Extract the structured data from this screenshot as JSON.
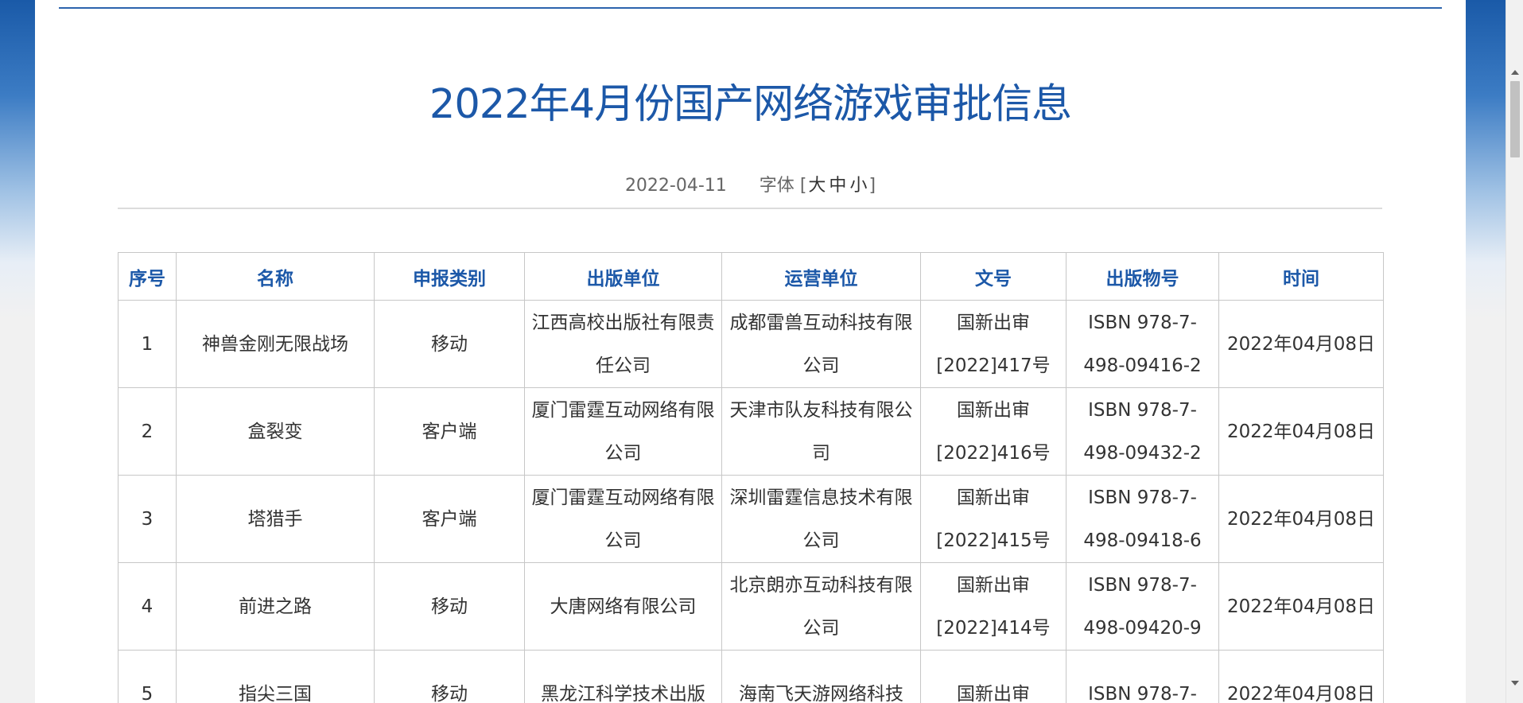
{
  "article": {
    "title": "2022年4月份国产网络游戏审批信息",
    "date": "2022-04-11",
    "font_label": "字体",
    "bracket_open": "[",
    "bracket_close": "]",
    "font_sizes": [
      "大",
      "中",
      "小"
    ]
  },
  "table": {
    "headers": [
      "序号",
      "名称",
      "申报类别",
      "出版单位",
      "运营单位",
      "文号",
      "出版物号",
      "时间"
    ],
    "rows": [
      [
        "1",
        "神兽金刚无限战场",
        "移动",
        "江西高校出版社有限责任公司",
        "成都雷兽互动科技有限公司",
        "国新出审[2022]417号",
        "ISBN 978-7-498-09416-2",
        "2022年04月08日"
      ],
      [
        "2",
        "盒裂变",
        "客户端",
        "厦门雷霆互动网络有限公司",
        "天津市队友科技有限公司",
        "国新出审[2022]416号",
        "ISBN 978-7-498-09432-2",
        "2022年04月08日"
      ],
      [
        "3",
        "塔猎手",
        "客户端",
        "厦门雷霆互动网络有限公司",
        "深圳雷霆信息技术有限公司",
        "国新出审[2022]415号",
        "ISBN 978-7-498-09418-6",
        "2022年04月08日"
      ],
      [
        "4",
        "前进之路",
        "移动",
        "大唐网络有限公司",
        "北京朗亦互动科技有限公司",
        "国新出审[2022]414号",
        "ISBN 978-7-498-09420-9",
        "2022年04月08日"
      ],
      [
        "5",
        "指尖三国",
        "移动",
        "黑龙江科学技术出版",
        "海南飞天游网络科技",
        "国新出审",
        "ISBN 978-7-",
        "2022年04月08日"
      ]
    ]
  }
}
